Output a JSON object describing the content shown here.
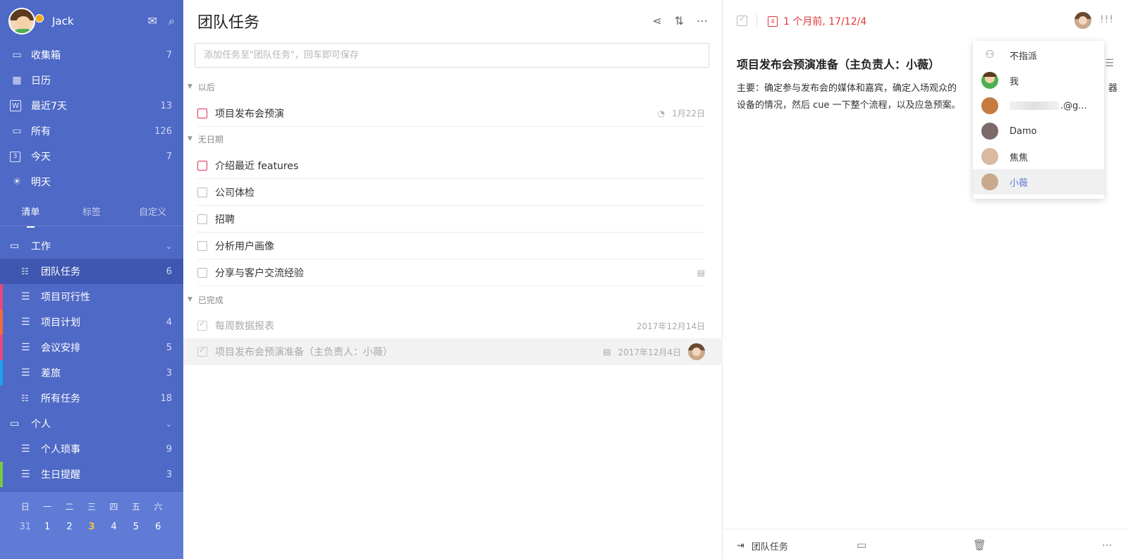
{
  "user": {
    "name": "Jack"
  },
  "smart_lists": [
    {
      "label": "收集箱",
      "count": "7",
      "icon": "inbox-icon",
      "glyph": "▭"
    },
    {
      "label": "日历",
      "count": "",
      "icon": "calendar-icon",
      "glyph": "▦"
    },
    {
      "label": "最近7天",
      "count": "13",
      "icon": "week-icon",
      "glyph": "W"
    },
    {
      "label": "所有",
      "count": "126",
      "icon": "all-icon",
      "glyph": "▭"
    },
    {
      "label": "今天",
      "count": "7",
      "icon": "today-icon",
      "glyph": "3"
    },
    {
      "label": "明天",
      "count": "",
      "icon": "tomorrow-icon",
      "glyph": "☀"
    }
  ],
  "tabs": [
    "清单",
    "标签",
    "自定义"
  ],
  "folders": {
    "work": {
      "label": "工作"
    },
    "personal": {
      "label": "个人"
    }
  },
  "work_lists": [
    {
      "label": "团队任务",
      "count": "6",
      "color": "",
      "active": true
    },
    {
      "label": "项目可行性",
      "count": "",
      "color": "#e8497a"
    },
    {
      "label": "项目计划",
      "count": "4",
      "color": "#f06a3c"
    },
    {
      "label": "会议安排",
      "count": "5",
      "color": "#e8497a"
    },
    {
      "label": "差旅",
      "count": "3",
      "color": "#1aa1f0"
    },
    {
      "label": "所有任务",
      "count": "18",
      "color": ""
    }
  ],
  "personal_lists": [
    {
      "label": "个人琐事",
      "count": "9",
      "color": ""
    },
    {
      "label": "生日提醒",
      "count": "3",
      "color": "#7ac943"
    }
  ],
  "calendar": {
    "weekdays": [
      "日",
      "一",
      "二",
      "三",
      "四",
      "五",
      "六"
    ],
    "days": [
      "31",
      "1",
      "2",
      "3",
      "4",
      "5",
      "6"
    ]
  },
  "middle": {
    "title": "团队任务",
    "input_placeholder": "添加任务至\"团队任务\"，回车即可保存",
    "sections": {
      "later": "以后",
      "nodate": "无日期",
      "done": "已完成"
    },
    "later_tasks": [
      {
        "title": "项目发布会预演",
        "date": "1月22日"
      }
    ],
    "nodate_tasks": [
      {
        "title": "介绍最近 features"
      },
      {
        "title": "公司体检"
      },
      {
        "title": "招聘"
      },
      {
        "title": "分析用户画像"
      },
      {
        "title": "分享与客户交流经验"
      }
    ],
    "done_tasks": [
      {
        "title": "每周数据报表",
        "date": "2017年12月14日"
      },
      {
        "title": "项目发布会预演准备（主负责人：小薇）",
        "date": "2017年12月4日"
      }
    ]
  },
  "detail": {
    "date_text": "1 个月前, 17/12/4",
    "date_icon_num": "4",
    "priority": "!!!",
    "title": "项目发布会预演准备（主负责人：小薇）",
    "body_line1": "主要：确定参与发布会的媒体和嘉宾，确定入场观众的",
    "body_line1_end": "器",
    "body_line2": "设备的情况，然后 cue 一下整个流程，以及应急预案。",
    "footer_list": "团队任务"
  },
  "assign_menu": [
    {
      "label": "不指派",
      "avatar": "none"
    },
    {
      "label": "我",
      "avatar": "me"
    },
    {
      "label": ".@g...",
      "avatar": "p1"
    },
    {
      "label": "Damo",
      "avatar": "p2"
    },
    {
      "label": "焦焦",
      "avatar": "p3"
    },
    {
      "label": "小薇",
      "avatar": "p4",
      "selected": true
    }
  ]
}
